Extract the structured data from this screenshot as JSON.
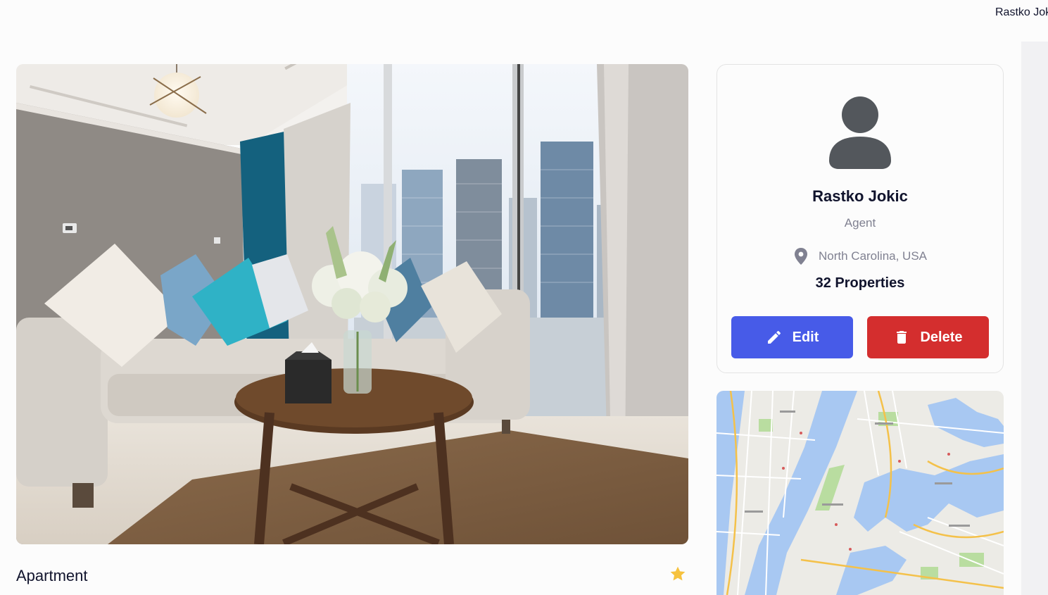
{
  "header": {
    "user_name": "Rastko Jokic"
  },
  "property": {
    "photo_icon": "living-room-photo",
    "type": "Apartment",
    "favorite_icon": "star-icon",
    "favorite_color": "#f6c23e"
  },
  "agent": {
    "avatar_icon": "user-avatar-icon",
    "name": "Rastko Jokic",
    "role": "Agent",
    "location_icon": "location-pin-icon",
    "location": "North Carolina, USA",
    "properties": "32 Properties",
    "edit_label": "Edit",
    "edit_icon": "pencil-icon",
    "delete_label": "Delete",
    "delete_icon": "trash-icon"
  },
  "colors": {
    "primary": "#475be8",
    "danger": "#d42e2e",
    "text_primary": "#11142d",
    "text_secondary": "#808191"
  },
  "map": {
    "icon": "map-image"
  }
}
